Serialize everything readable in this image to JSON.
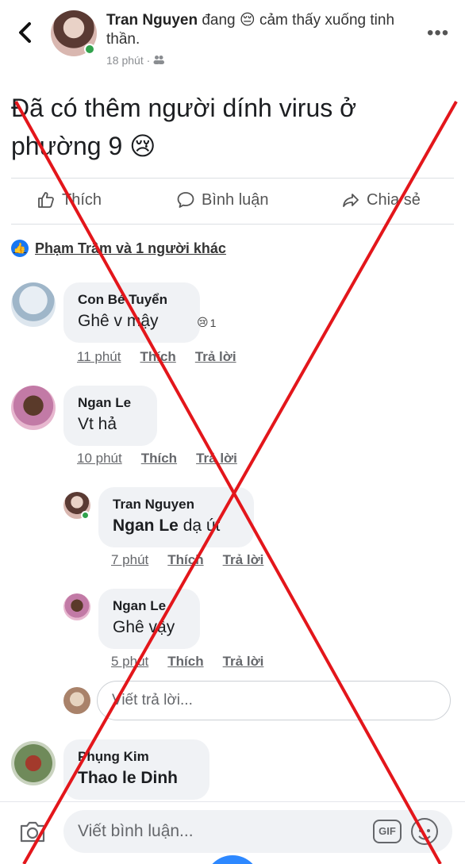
{
  "header": {
    "back_label": "‹",
    "author": "Tran Nguyen",
    "status_text": "đang 😔 cảm thấy xuống tinh thần.",
    "time": "18 phút",
    "more_label": "•••"
  },
  "post": {
    "text": "Đã có thêm người dính virus ở phường 9 😢"
  },
  "actions": {
    "like": "Thích",
    "comment": "Bình luận",
    "share": "Chia sẻ"
  },
  "reactions": {
    "summary": "Phạm Trâm và 1 người khác",
    "icon": "👍"
  },
  "comments": [
    {
      "name": "Con Bé Tuyển",
      "text": "Ghê v mậy",
      "time": "11 phút",
      "like": "Thích",
      "reply": "Trả lời",
      "reaction_icon": "😢",
      "reaction_count": "1"
    },
    {
      "name": "Ngan Le",
      "text": "Vt hả",
      "time": "10 phút",
      "like": "Thích",
      "reply": "Trả lời"
    },
    {
      "name": "Tran Nguyen",
      "tag": "Ngan Le",
      "text": "dạ út",
      "time": "7 phút",
      "like": "Thích",
      "reply": "Trả lời"
    },
    {
      "name": "Ngan Le",
      "text": "Ghê vậy",
      "time": "5 phút",
      "like": "Thích",
      "reply": "Trả lời"
    },
    {
      "name": "Phụng Kim",
      "text": "Thao le Dinh"
    }
  ],
  "reply_placeholder": "Viết trả lời...",
  "comment_placeholder": "Viết bình luận...",
  "gif_label": "GIF",
  "colors": {
    "accent": "#1877f2",
    "strike": "#e3161b",
    "online": "#31a24c"
  }
}
